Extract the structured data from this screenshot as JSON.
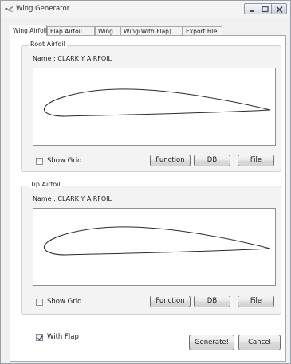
{
  "window": {
    "title": "Wing Generator",
    "icon": "wing-app-icon"
  },
  "tabs": [
    {
      "label": "Wing Airfoil",
      "active": true
    },
    {
      "label": "Flap Airfoil",
      "active": false
    },
    {
      "label": "Wing",
      "active": false
    },
    {
      "label": "Wing(With Flap)",
      "active": false
    },
    {
      "label": "Export File",
      "active": false
    }
  ],
  "root": {
    "group_title": "Root Airfoil",
    "name_line": "Name : CLARK Y AIRFOIL",
    "show_grid_label": "Show Grid",
    "show_grid_checked": false,
    "buttons": {
      "function": "Function",
      "db": "DB",
      "file": "File"
    }
  },
  "tip": {
    "group_title": "Tip Airfoil",
    "name_line": "Name : CLARK Y AIRFOIL",
    "show_grid_label": "Show Grid",
    "show_grid_checked": false,
    "buttons": {
      "function": "Function",
      "db": "DB",
      "file": "File"
    }
  },
  "footer": {
    "with_flap_label": "With Flap",
    "with_flap_checked": true,
    "generate_label": "Generate!",
    "cancel_label": "Cancel"
  }
}
